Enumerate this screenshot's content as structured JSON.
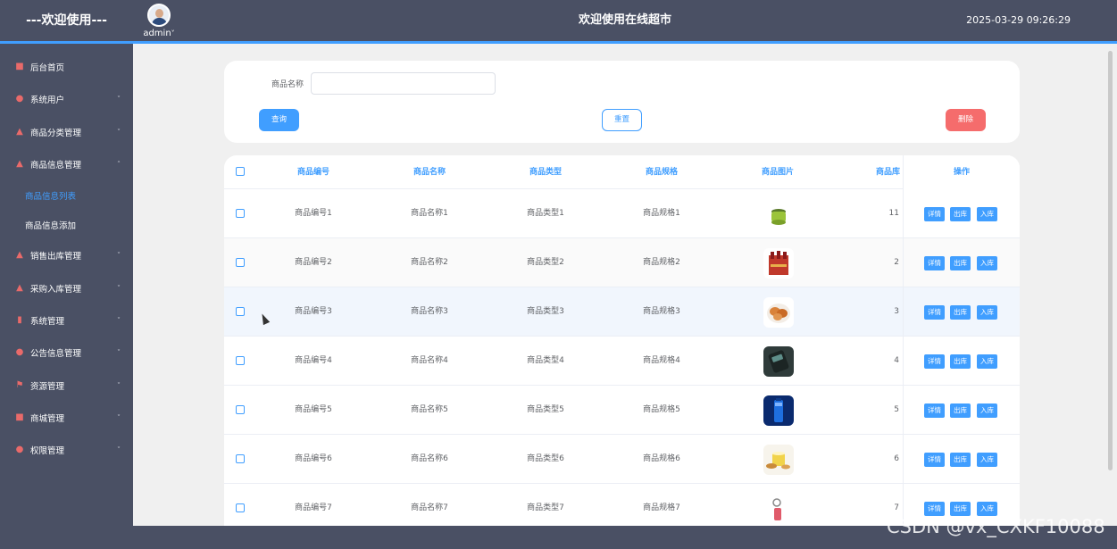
{
  "header": {
    "brand": "---欢迎使用---",
    "username": "admin",
    "username_caret": "˅",
    "title": "欢迎使用在线超市",
    "datetime": "2025-03-29 09:26:29"
  },
  "sidebar": {
    "items": [
      {
        "label": "后台首页",
        "icon": "monitor-icon",
        "glyph": "■"
      },
      {
        "label": "系统用户",
        "icon": "user-icon",
        "glyph": "●"
      },
      {
        "label": "商品分类管理",
        "icon": "chart-icon",
        "glyph": "▲"
      },
      {
        "label": "商品信息管理",
        "icon": "chart-icon",
        "glyph": "▲",
        "expanded": true
      },
      {
        "label": "销售出库管理",
        "icon": "chart-icon",
        "glyph": "▲"
      },
      {
        "label": "采购入库管理",
        "icon": "chart-icon",
        "glyph": "▲"
      },
      {
        "label": "系统管理",
        "icon": "bar-chart-icon",
        "glyph": "▮"
      },
      {
        "label": "公告信息管理",
        "icon": "info-icon",
        "glyph": "●"
      },
      {
        "label": "资源管理",
        "icon": "flag-icon",
        "glyph": "⚑"
      },
      {
        "label": "商城管理",
        "icon": "monitor-icon",
        "glyph": "■"
      },
      {
        "label": "权限管理",
        "icon": "user-icon",
        "glyph": "●"
      }
    ],
    "subitems": [
      "商品信息列表",
      "商品信息添加"
    ],
    "chevron": "˅",
    "chevron_up": "˄"
  },
  "search": {
    "label": "商品名称",
    "value": "",
    "placeholder": "",
    "query_label": "查询",
    "reset_label": "重置",
    "delete_label": "删除"
  },
  "table": {
    "columns": [
      "商品编号",
      "商品名称",
      "商品类型",
      "商品规格",
      "商品图片",
      "商品库",
      "操作"
    ],
    "action_labels": [
      "详情",
      "出库",
      "入库"
    ],
    "rows": [
      {
        "code": "商品编号1",
        "name": "商品名称1",
        "type": "商品类型1",
        "spec": "商品规格1",
        "stock": "11"
      },
      {
        "code": "商品编号2",
        "name": "商品名称2",
        "type": "商品类型2",
        "spec": "商品规格2",
        "stock": "2"
      },
      {
        "code": "商品编号3",
        "name": "商品名称3",
        "type": "商品类型3",
        "spec": "商品规格3",
        "stock": "3"
      },
      {
        "code": "商品编号4",
        "name": "商品名称4",
        "type": "商品类型4",
        "spec": "商品规格4",
        "stock": "4"
      },
      {
        "code": "商品编号5",
        "name": "商品名称5",
        "type": "商品类型5",
        "spec": "商品规格5",
        "stock": "5"
      },
      {
        "code": "商品编号6",
        "name": "商品名称6",
        "type": "商品类型6",
        "spec": "商品规格6",
        "stock": "6"
      },
      {
        "code": "商品编号7",
        "name": "商品名称7",
        "type": "商品类型7",
        "spec": "商品规格7",
        "stock": "7"
      }
    ]
  },
  "watermark": "CSDN @vx_CXKF10088",
  "colors": {
    "primary": "#409eff",
    "danger": "#f56c6c",
    "sidebar_bg": "#4a5064",
    "content_bg": "#f0f0f0"
  }
}
